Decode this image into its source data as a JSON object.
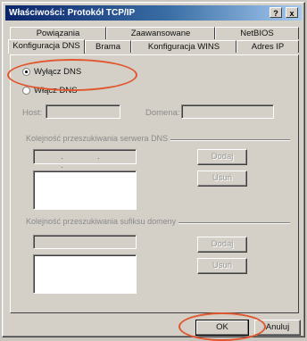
{
  "window": {
    "title": "Właściwości: Protokół TCP/IP",
    "help_btn": "?",
    "close_btn": "x"
  },
  "tabs": {
    "row1": [
      "Powiązania",
      "Zaawansowane",
      "NetBIOS"
    ],
    "row2": [
      "Konfiguracja DNS",
      "Brama",
      "Konfiguracja WINS",
      "Adres IP"
    ],
    "active": "Konfiguracja DNS"
  },
  "dns": {
    "disable_label": "Wyłącz DNS",
    "enable_label": "Włącz DNS",
    "selected": "Wyłącz DNS",
    "host_label": "Host:",
    "domain_label": "Domena:",
    "servers_group_label": "Kolejność przeszukiwania serwera DNS",
    "ip_dots": ". . .",
    "add_label": "Dodaj",
    "remove_label": "Usuń",
    "suffix_group_label": "Kolejność przeszukiwania sufiksu domeny",
    "add2_label": "Dodaj",
    "remove2_label": "Usuń"
  },
  "footer": {
    "ok_label": "OK",
    "cancel_label": "Anuluj"
  },
  "colors": {
    "highlight": "#e0572e",
    "titlebar": "#0a246a"
  }
}
